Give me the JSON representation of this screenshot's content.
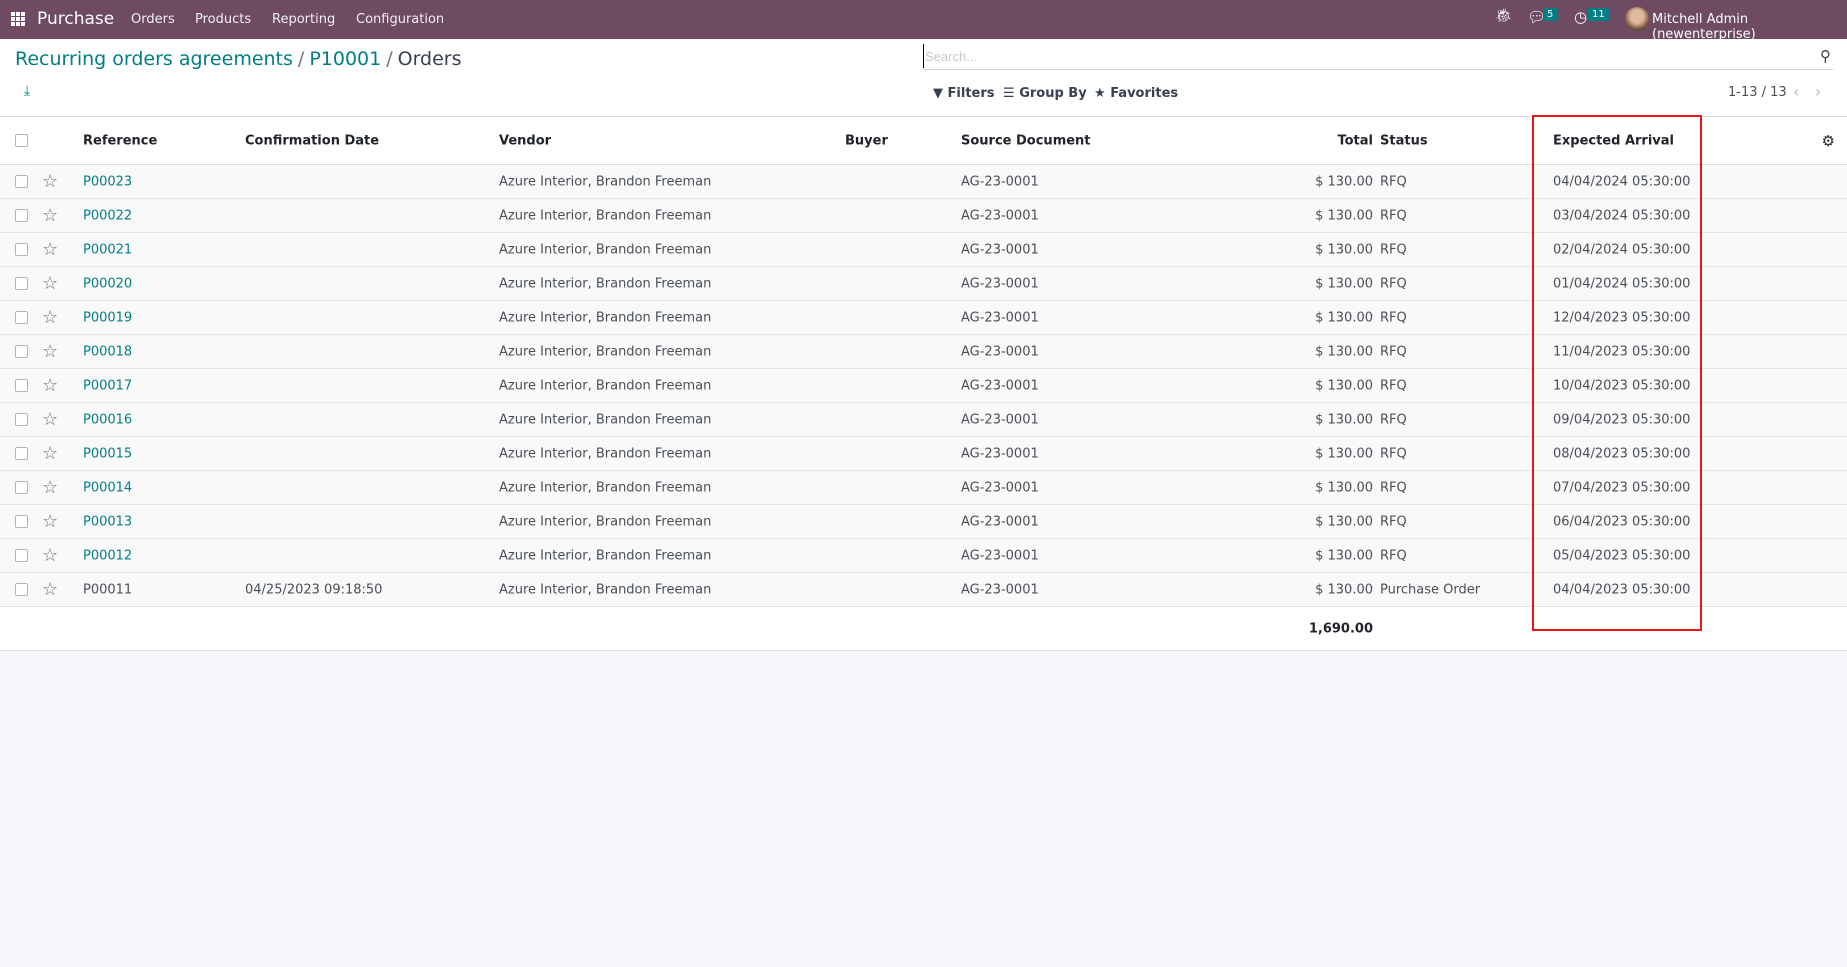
{
  "navbar": {
    "app_name": "Purchase",
    "menu": [
      "Orders",
      "Products",
      "Reporting",
      "Configuration"
    ],
    "messages_count": "5",
    "activities_count": "11",
    "user": "Mitchell Admin (newenterprise)"
  },
  "breadcrumb": {
    "items": [
      "Recurring orders agreements",
      "P10001"
    ],
    "current": "Orders",
    "separator": "/"
  },
  "search": {
    "placeholder": "Search..."
  },
  "filters": {
    "filters": "Filters",
    "group_by": "Group By",
    "favorites": "Favorites"
  },
  "pager": {
    "text": "1-13 / 13"
  },
  "table": {
    "headers": {
      "reference": "Reference",
      "confirmation_date": "Confirmation Date",
      "vendor": "Vendor",
      "buyer": "Buyer",
      "source_document": "Source Document",
      "total": "Total",
      "status": "Status",
      "expected_arrival": "Expected Arrival"
    },
    "rows": [
      {
        "reference": "P00023",
        "confirmation_date": "",
        "vendor": "Azure Interior, Brandon Freeman",
        "buyer": "",
        "source_document": "AG-23-0001",
        "total": "$ 130.00",
        "status": "RFQ",
        "expected_arrival": "04/04/2024 05:30:00"
      },
      {
        "reference": "P00022",
        "confirmation_date": "",
        "vendor": "Azure Interior, Brandon Freeman",
        "buyer": "",
        "source_document": "AG-23-0001",
        "total": "$ 130.00",
        "status": "RFQ",
        "expected_arrival": "03/04/2024 05:30:00"
      },
      {
        "reference": "P00021",
        "confirmation_date": "",
        "vendor": "Azure Interior, Brandon Freeman",
        "buyer": "",
        "source_document": "AG-23-0001",
        "total": "$ 130.00",
        "status": "RFQ",
        "expected_arrival": "02/04/2024 05:30:00"
      },
      {
        "reference": "P00020",
        "confirmation_date": "",
        "vendor": "Azure Interior, Brandon Freeman",
        "buyer": "",
        "source_document": "AG-23-0001",
        "total": "$ 130.00",
        "status": "RFQ",
        "expected_arrival": "01/04/2024 05:30:00"
      },
      {
        "reference": "P00019",
        "confirmation_date": "",
        "vendor": "Azure Interior, Brandon Freeman",
        "buyer": "",
        "source_document": "AG-23-0001",
        "total": "$ 130.00",
        "status": "RFQ",
        "expected_arrival": "12/04/2023 05:30:00"
      },
      {
        "reference": "P00018",
        "confirmation_date": "",
        "vendor": "Azure Interior, Brandon Freeman",
        "buyer": "",
        "source_document": "AG-23-0001",
        "total": "$ 130.00",
        "status": "RFQ",
        "expected_arrival": "11/04/2023 05:30:00"
      },
      {
        "reference": "P00017",
        "confirmation_date": "",
        "vendor": "Azure Interior, Brandon Freeman",
        "buyer": "",
        "source_document": "AG-23-0001",
        "total": "$ 130.00",
        "status": "RFQ",
        "expected_arrival": "10/04/2023 05:30:00"
      },
      {
        "reference": "P00016",
        "confirmation_date": "",
        "vendor": "Azure Interior, Brandon Freeman",
        "buyer": "",
        "source_document": "AG-23-0001",
        "total": "$ 130.00",
        "status": "RFQ",
        "expected_arrival": "09/04/2023 05:30:00"
      },
      {
        "reference": "P00015",
        "confirmation_date": "",
        "vendor": "Azure Interior, Brandon Freeman",
        "buyer": "",
        "source_document": "AG-23-0001",
        "total": "$ 130.00",
        "status": "RFQ",
        "expected_arrival": "08/04/2023 05:30:00"
      },
      {
        "reference": "P00014",
        "confirmation_date": "",
        "vendor": "Azure Interior, Brandon Freeman",
        "buyer": "",
        "source_document": "AG-23-0001",
        "total": "$ 130.00",
        "status": "RFQ",
        "expected_arrival": "07/04/2023 05:30:00"
      },
      {
        "reference": "P00013",
        "confirmation_date": "",
        "vendor": "Azure Interior, Brandon Freeman",
        "buyer": "",
        "source_document": "AG-23-0001",
        "total": "$ 130.00",
        "status": "RFQ",
        "expected_arrival": "06/04/2023 05:30:00"
      },
      {
        "reference": "P00012",
        "confirmation_date": "",
        "vendor": "Azure Interior, Brandon Freeman",
        "buyer": "",
        "source_document": "AG-23-0001",
        "total": "$ 130.00",
        "status": "RFQ",
        "expected_arrival": "05/04/2023 05:30:00"
      },
      {
        "reference": "P00011",
        "confirmation_date": "04/25/2023 09:18:50",
        "vendor": "Azure Interior, Brandon Freeman",
        "buyer": "",
        "source_document": "AG-23-0001",
        "total": "$ 130.00",
        "status": "Purchase Order",
        "expected_arrival": "04/04/2023 05:30:00"
      }
    ],
    "footer_total": "1,690.00"
  },
  "colors": {
    "navbar": "#6e4a63",
    "accent": "#017e84",
    "highlight": "#e8141c"
  }
}
